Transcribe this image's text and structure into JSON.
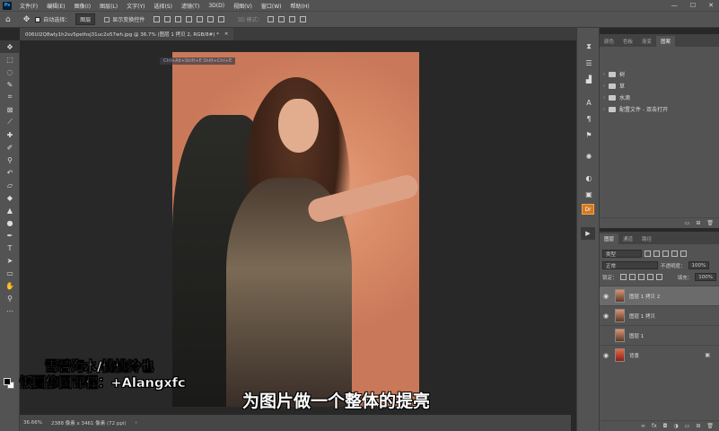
{
  "menubar": {
    "logo": "Ps",
    "items": [
      "文件(F)",
      "编辑(E)",
      "图像(I)",
      "图层(L)",
      "文字(Y)",
      "选择(S)",
      "滤镜(T)",
      "3D(D)",
      "视图(V)",
      "窗口(W)",
      "帮助(H)"
    ],
    "win_min": "—",
    "win_max": "☐",
    "win_close": "✕"
  },
  "options": {
    "auto_select": "自动选择：",
    "auto_select_value": "图层",
    "show_transform": "显示变换控件",
    "mode_3d": "3D 模式："
  },
  "document": {
    "tab_title": "006Ul2Q8wly1h2sv5pethsj31uc2o57wh.jpg @ 36.7% (图层 1 拷贝 2, RGB/8#) *",
    "tab_close": "×",
    "tooltip": "Ctrl+Alt+Shift+E    Shift+Ctrl+E"
  },
  "status": {
    "zoom": "36.66%",
    "doc_info": "2388 像素 x 3461 像素 (72 ppi)",
    "arrow": "›"
  },
  "watermark": {
    "line1": "雪碧海水/桃桃泠也",
    "line2": "饭圈修图课程：+Alangxfc"
  },
  "subtitle": "为图片做一个整体的提亮",
  "libraries": {
    "tabs": [
      "颜色",
      "色板",
      "渐变",
      "图案"
    ],
    "active_tab": "图案",
    "items": [
      "树",
      "草",
      "水滴",
      "配置文件 - 双击打开"
    ]
  },
  "layers": {
    "tabs": [
      "图层",
      "通道",
      "路径"
    ],
    "active_tab": "图层",
    "filter": "类型",
    "blend_mode": "正常",
    "opacity_label": "不透明度：",
    "opacity_value": "100%",
    "lock_label": "锁定：",
    "fill_label": "填充：",
    "fill_value": "100%",
    "items": [
      {
        "name": "图层 1 拷贝 2",
        "visible": true,
        "selected": true
      },
      {
        "name": "图层 1 拷贝",
        "visible": true,
        "selected": false
      },
      {
        "name": "图层 1",
        "visible": false,
        "selected": false
      },
      {
        "name": "背景",
        "visible": true,
        "selected": false,
        "locked": true
      }
    ]
  },
  "dock": {
    "lr_label": "Dr"
  },
  "icons": {
    "home": "⌂",
    "move": "✥",
    "eye": "◉",
    "lock": "🔒",
    "play": "▶",
    "chevron": "›"
  }
}
